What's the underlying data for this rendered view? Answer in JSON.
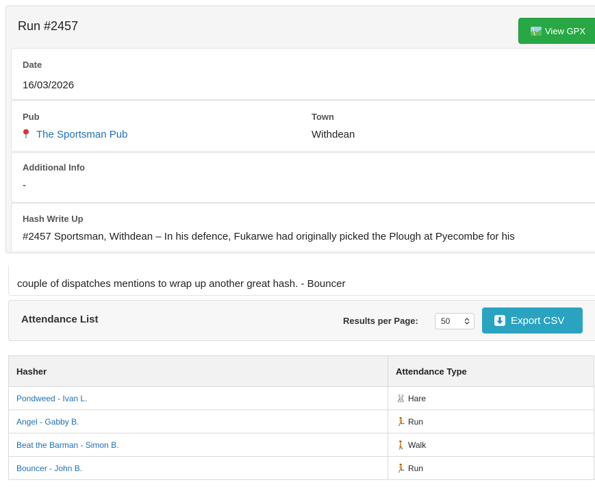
{
  "run": {
    "title": "Run #2457",
    "gpx_button": "View GPX",
    "date_label": "Date",
    "date_value": "16/03/2026",
    "pub_label": "Pub",
    "pub_value": "The Sportsman Pub",
    "town_label": "Town",
    "town_value": "Withdean",
    "info_label": "Additional Info",
    "info_value": "-",
    "writeup_label": "Hash Write Up",
    "writeup_first_line": "#2457 Sportsman, Withdean – In his defence, Fukarwe had originally picked the Plough at Pyecombe for his",
    "writeup_last_line": "couple of dispatches mentions to wrap up another great hash. - Bouncer"
  },
  "attendance": {
    "title": "Attendance List",
    "results_per_page_label": "Results per Page:",
    "results_per_page_value": "50",
    "export_button": "Export CSV",
    "columns": [
      "Hasher",
      "Attendance Type"
    ],
    "rows": [
      {
        "hasher": "Pondweed - Ivan L.",
        "type": "Hare",
        "icon": "rabbit-icon"
      },
      {
        "hasher": "Angel - Gabby B.",
        "type": "Run",
        "icon": "runner-icon"
      },
      {
        "hasher": "Beat the Barman - Simon B.",
        "type": "Walk",
        "icon": "walker-icon"
      },
      {
        "hasher": "Bouncer - John B.",
        "type": "Run",
        "icon": "runner-icon"
      }
    ]
  },
  "colors": {
    "gpx_green": "#28a745",
    "csv_blue": "#2aa3c1",
    "link_blue": "#1f6fb5",
    "pin_red": "#d9363e"
  }
}
